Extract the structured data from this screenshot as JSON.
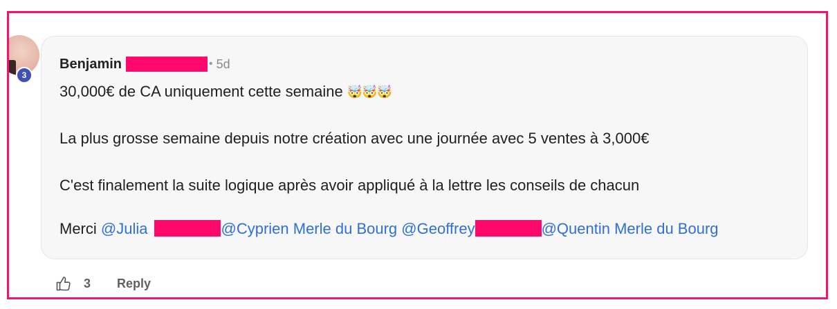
{
  "comment": {
    "author_first_name": "Benjamin",
    "separator": "•",
    "timestamp": "5d",
    "level": "3",
    "lines": [
      "30,000€ de CA uniquement cette semaine",
      "La plus grosse semaine depuis notre création avec une journée avec 5 ventes à 3,000€",
      "C'est finalement la suite logique après avoir appliqué à la lettre les conseils de chacun"
    ],
    "emojis": "🤯🤯🤯",
    "thanks": {
      "prefix": "Merci ",
      "mentions": [
        "@Julia",
        "@Cyprien Merle du Bourg",
        "@Geoffrey",
        "@Quentin Merle du Bourg"
      ]
    }
  },
  "reactions": {
    "like_count": "3",
    "reply_label": "Reply"
  },
  "colors": {
    "frame_border": "#f0136f",
    "redaction": "#ff0a6c",
    "mention": "#2f6fd6",
    "level_badge": "#3f51b5"
  },
  "icons": {
    "like": "thumbs-up-icon"
  }
}
